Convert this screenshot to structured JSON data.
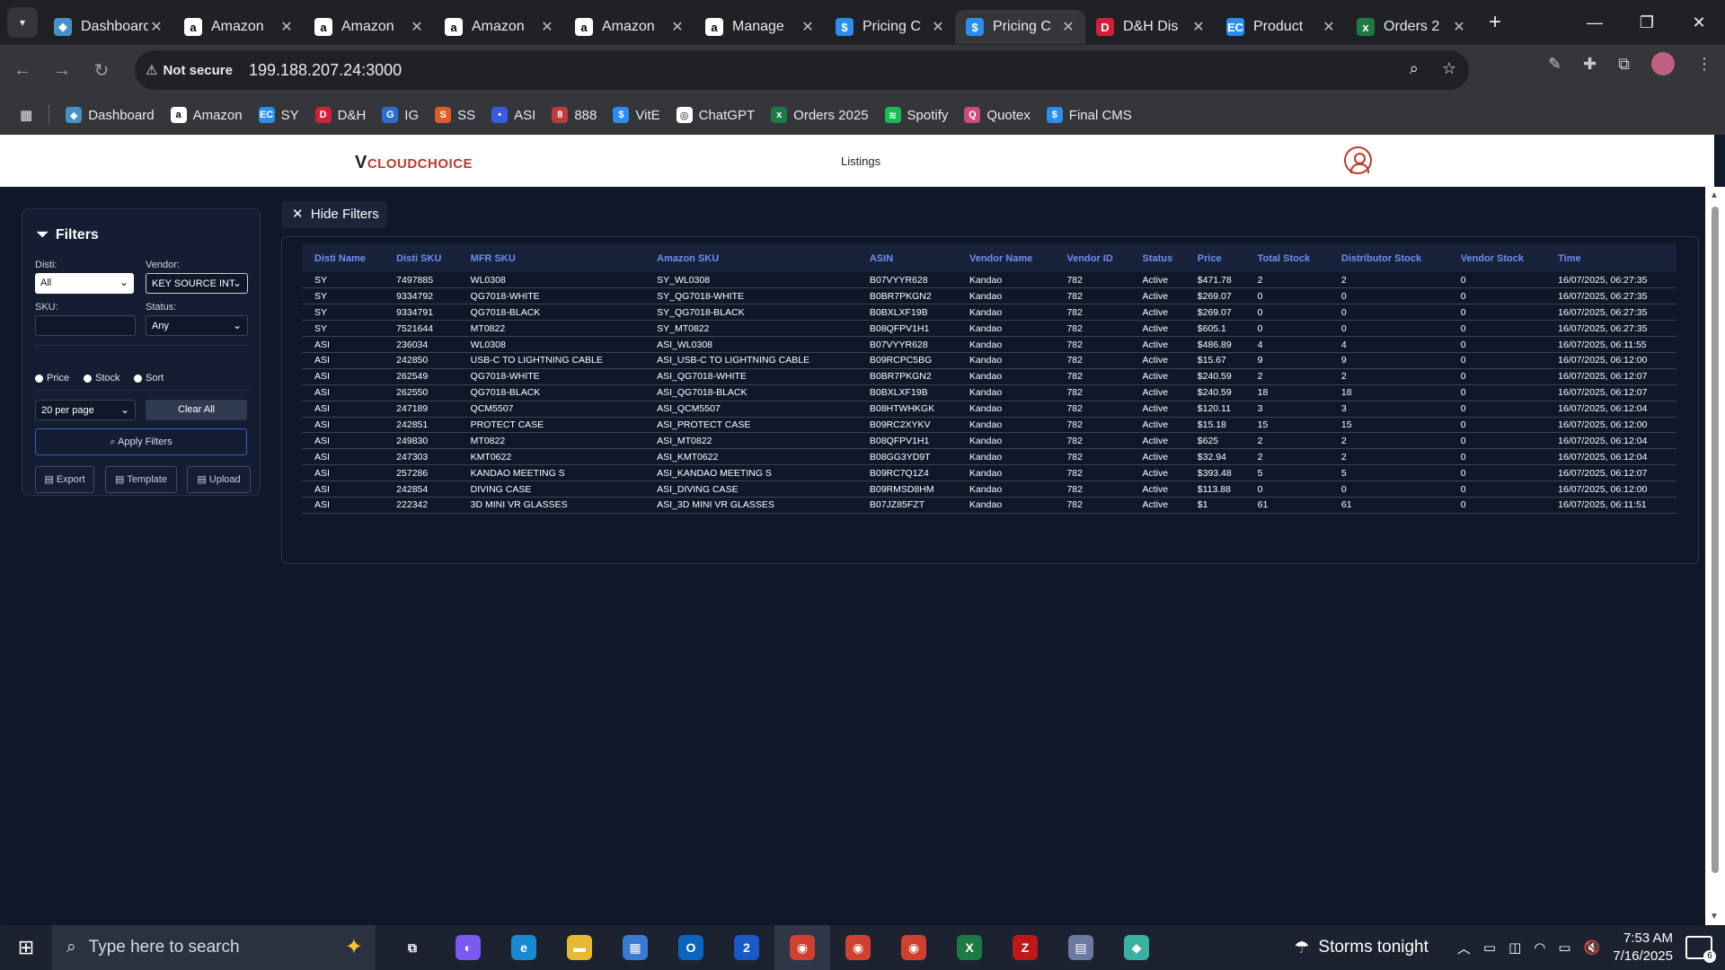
{
  "browser": {
    "tabs": [
      {
        "title": "Dashboard",
        "icon": "dashboard-icon",
        "color": "#4a90c8",
        "glyph": "◆",
        "active": false
      },
      {
        "title": "Amazon",
        "icon": "amazon-icon",
        "color": "#ffffff",
        "glyph": "a",
        "active": false
      },
      {
        "title": "Amazon",
        "icon": "amazon-icon",
        "color": "#ffffff",
        "glyph": "a",
        "active": false
      },
      {
        "title": "Amazon",
        "icon": "amazon-icon",
        "color": "#ffffff",
        "glyph": "a",
        "active": false
      },
      {
        "title": "Amazon",
        "icon": "amazon-icon",
        "color": "#ffffff",
        "glyph": "a",
        "active": false
      },
      {
        "title": "Manage",
        "icon": "amazon-icon",
        "color": "#ffffff",
        "glyph": "a",
        "active": false
      },
      {
        "title": "Pricing C",
        "icon": "dollar-icon",
        "color": "#2a8df0",
        "glyph": "$",
        "active": false
      },
      {
        "title": "Pricing C",
        "icon": "dollar-icon",
        "color": "#2a8df0",
        "glyph": "$",
        "active": true
      },
      {
        "title": "D&H Dis",
        "icon": "dh-icon",
        "color": "#d0203a",
        "glyph": "D",
        "active": false
      },
      {
        "title": "Product",
        "icon": "ec-icon",
        "color": "#2a8df0",
        "glyph": "EC",
        "active": false
      },
      {
        "title": "Orders 2",
        "icon": "excel-icon",
        "color": "#1d7a45",
        "glyph": "x",
        "active": false
      }
    ],
    "security_label": "Not secure",
    "url": "199.188.207.24:3000",
    "bookmarks": [
      {
        "label": "Dashboard",
        "icon": "dashboard-icon",
        "color": "#4a90c8",
        "glyph": "◆"
      },
      {
        "label": "Amazon",
        "icon": "amazon-icon",
        "color": "#ffffff",
        "glyph": "a"
      },
      {
        "label": "SY",
        "icon": "ec-icon",
        "color": "#2a8df0",
        "glyph": "EC"
      },
      {
        "label": "D&H",
        "icon": "dh-icon",
        "color": "#d0203a",
        "glyph": "D"
      },
      {
        "label": "IG",
        "icon": "ig-icon",
        "color": "#2a6fd0",
        "glyph": "G"
      },
      {
        "label": "SS",
        "icon": "ss-icon",
        "color": "#e05a2a",
        "glyph": "S"
      },
      {
        "label": "ASI",
        "icon": "asi-icon",
        "color": "#3a5be0",
        "glyph": "•"
      },
      {
        "label": "888",
        "icon": "888-icon",
        "color": "#c03a3a",
        "glyph": "8"
      },
      {
        "label": "VitE",
        "icon": "dollar-icon",
        "color": "#2a8df0",
        "glyph": "$"
      },
      {
        "label": "ChatGPT",
        "icon": "chatgpt-icon",
        "color": "#ffffff",
        "glyph": "◎"
      },
      {
        "label": "Orders 2025",
        "icon": "excel-icon",
        "color": "#1d7a45",
        "glyph": "x"
      },
      {
        "label": "Spotify",
        "icon": "spotify-icon",
        "color": "#1db954",
        "glyph": "≋"
      },
      {
        "label": "Quotex",
        "icon": "quotex-icon",
        "color": "#d04a7a",
        "glyph": "Q"
      },
      {
        "label": "Final CMS",
        "icon": "dollar-icon",
        "color": "#2a8df0",
        "glyph": "$"
      }
    ]
  },
  "app": {
    "logo_v": "V",
    "logo_text": "CLOUDCHOICE",
    "nav_listings": "Listings"
  },
  "filters": {
    "title": "Filters",
    "disti_label": "Disti:",
    "disti_value": "All",
    "vendor_label": "Vendor:",
    "vendor_value": "KEY SOURCE INT",
    "sku_label": "SKU:",
    "sku_value": "",
    "status_label": "Status:",
    "status_value": "Any",
    "radio_price": "Price",
    "radio_stock": "Stock",
    "radio_sort": "Sort",
    "per_page": "20 per page",
    "clear_all": "Clear All",
    "apply": "Apply Filters",
    "export": "Export",
    "template": "Template",
    "upload": "Upload",
    "hide_filters": "Hide Filters"
  },
  "table": {
    "columns": [
      "Disti Name",
      "Disti SKU",
      "MFR SKU",
      "Amazon SKU",
      "ASIN",
      "Vendor Name",
      "Vendor ID",
      "Status",
      "Price",
      "Total Stock",
      "Distributor Stock",
      "Vendor Stock",
      "Time"
    ],
    "rows": [
      [
        "SY",
        "7497885",
        "WL0308",
        "SY_WL0308",
        "B07VYYR628",
        "Kandao",
        "782",
        "Active",
        "$471.78",
        "2",
        "2",
        "0",
        "16/07/2025, 06:27:35"
      ],
      [
        "SY",
        "9334792",
        "QG7018-WHITE",
        "SY_QG7018-WHITE",
        "B0BR7PKGN2",
        "Kandao",
        "782",
        "Active",
        "$269.07",
        "0",
        "0",
        "0",
        "16/07/2025, 06:27:35"
      ],
      [
        "SY",
        "9334791",
        "QG7018-BLACK",
        "SY_QG7018-BLACK",
        "B0BXLXF19B",
        "Kandao",
        "782",
        "Active",
        "$269.07",
        "0",
        "0",
        "0",
        "16/07/2025, 06:27:35"
      ],
      [
        "SY",
        "7521644",
        "MT0822",
        "SY_MT0822",
        "B08QFPV1H1",
        "Kandao",
        "782",
        "Active",
        "$605.1",
        "0",
        "0",
        "0",
        "16/07/2025, 06:27:35"
      ],
      [
        "ASI",
        "236034",
        "WL0308",
        "ASI_WL0308",
        "B07VYYR628",
        "Kandao",
        "782",
        "Active",
        "$486.89",
        "4",
        "4",
        "0",
        "16/07/2025, 06:11:55"
      ],
      [
        "ASI",
        "242850",
        "USB-C TO LIGHTNING CABLE",
        "ASI_USB-C TO LIGHTNING CABLE",
        "B09RCPC5BG",
        "Kandao",
        "782",
        "Active",
        "$15.67",
        "9",
        "9",
        "0",
        "16/07/2025, 06:12:00"
      ],
      [
        "ASI",
        "262549",
        "QG7018-WHITE",
        "ASI_QG7018-WHITE",
        "B0BR7PKGN2",
        "Kandao",
        "782",
        "Active",
        "$240.59",
        "2",
        "2",
        "0",
        "16/07/2025, 06:12:07"
      ],
      [
        "ASI",
        "262550",
        "QG7018-BLACK",
        "ASI_QG7018-BLACK",
        "B0BXLXF19B",
        "Kandao",
        "782",
        "Active",
        "$240.59",
        "18",
        "18",
        "0",
        "16/07/2025, 06:12:07"
      ],
      [
        "ASI",
        "247189",
        "QCM5507",
        "ASI_QCM5507",
        "B08HTWHKGK",
        "Kandao",
        "782",
        "Active",
        "$120.11",
        "3",
        "3",
        "0",
        "16/07/2025, 06:12:04"
      ],
      [
        "ASI",
        "242851",
        "PROTECT CASE",
        "ASI_PROTECT CASE",
        "B09RC2XYKV",
        "Kandao",
        "782",
        "Active",
        "$15.18",
        "15",
        "15",
        "0",
        "16/07/2025, 06:12:00"
      ],
      [
        "ASI",
        "249830",
        "MT0822",
        "ASI_MT0822",
        "B08QFPV1H1",
        "Kandao",
        "782",
        "Active",
        "$625",
        "2",
        "2",
        "0",
        "16/07/2025, 06:12:04"
      ],
      [
        "ASI",
        "247303",
        "KMT0622",
        "ASI_KMT0622",
        "B08GG3YD9T",
        "Kandao",
        "782",
        "Active",
        "$32.94",
        "2",
        "2",
        "0",
        "16/07/2025, 06:12:04"
      ],
      [
        "ASI",
        "257286",
        "KANDAO MEETING S",
        "ASI_KANDAO MEETING S",
        "B09RC7Q1Z4",
        "Kandao",
        "782",
        "Active",
        "$393.48",
        "5",
        "5",
        "0",
        "16/07/2025, 06:12:07"
      ],
      [
        "ASI",
        "242854",
        "DIVING CASE",
        "ASI_DIVING CASE",
        "B09RMSD8HM",
        "Kandao",
        "782",
        "Active",
        "$113.88",
        "0",
        "0",
        "0",
        "16/07/2025, 06:12:00"
      ],
      [
        "ASI",
        "222342",
        "3D MINI VR GLASSES",
        "ASI_3D MINI VR GLASSES",
        "B07JZ85FZT",
        "Kandao",
        "782",
        "Active",
        "$1",
        "61",
        "61",
        "0",
        "16/07/2025, 06:11:51"
      ]
    ]
  },
  "taskbar": {
    "search_placeholder": "Type here to search",
    "weather": "Storms tonight",
    "time": "7:53 AM",
    "date": "7/16/2025",
    "notifications": "6",
    "apps": [
      {
        "name": "task-view-icon",
        "color": "#1c2230",
        "glyph": "⧉"
      },
      {
        "name": "copilot-icon",
        "color": "#7a5af0",
        "glyph": "◐"
      },
      {
        "name": "edge-icon",
        "color": "#1a8ad0",
        "glyph": "e"
      },
      {
        "name": "file-explorer-icon",
        "color": "#e8b830",
        "glyph": "▬"
      },
      {
        "name": "store-icon",
        "color": "#3a7ad0",
        "glyph": "▦"
      },
      {
        "name": "outlook-icon",
        "color": "#0a64c0",
        "glyph": "O"
      },
      {
        "name": "calendar-icon",
        "color": "#1a5ac8",
        "glyph": "2"
      },
      {
        "name": "chrome-icon",
        "color": "#d04030",
        "glyph": "◉"
      },
      {
        "name": "chrome-icon",
        "color": "#d04030",
        "glyph": "◉"
      },
      {
        "name": "chrome-icon",
        "color": "#d04030",
        "glyph": "◉"
      },
      {
        "name": "excel-icon",
        "color": "#1d7a45",
        "glyph": "X"
      },
      {
        "name": "filezilla-icon",
        "color": "#c01818",
        "glyph": "Z"
      },
      {
        "name": "calculator-icon",
        "color": "#6a7aa0",
        "glyph": "▤"
      },
      {
        "name": "vpn-icon",
        "color": "#3ab0a0",
        "glyph": "◆"
      }
    ]
  }
}
